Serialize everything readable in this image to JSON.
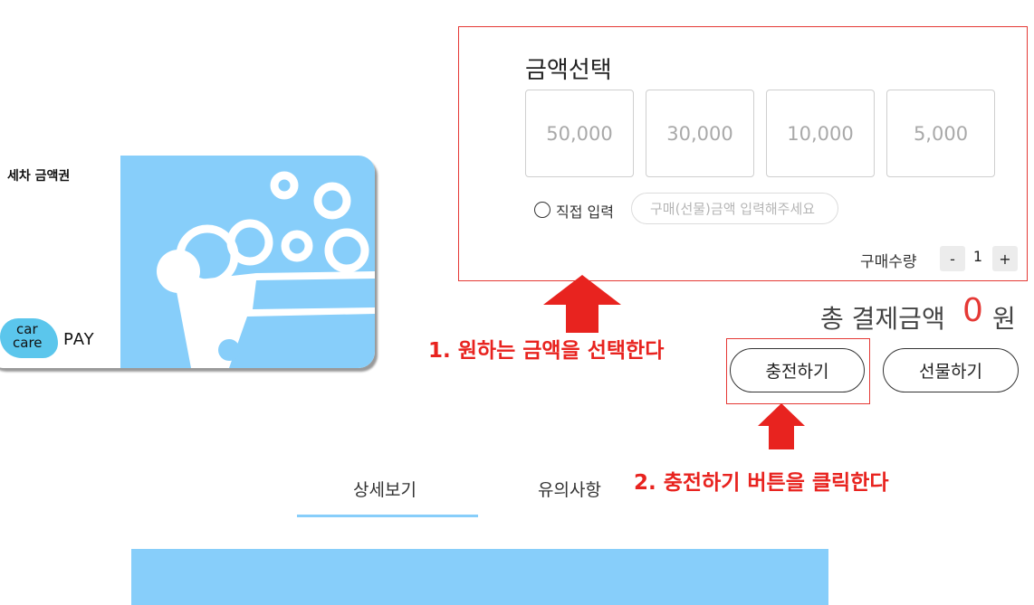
{
  "card": {
    "title": "세차 금액권",
    "logo_car": "car",
    "logo_care": "care",
    "logo_pay": "PAY",
    "art_color": "#87cefa"
  },
  "amount_select": {
    "title": "금액선택",
    "options": [
      "50,000",
      "30,000",
      "10,000",
      "5,000"
    ],
    "direct_input_label": "직접 입력",
    "direct_input_placeholder": "구매(선물)금액 입력해주세요"
  },
  "quantity": {
    "label": "구매수량",
    "minus": "-",
    "value": "1",
    "plus": "+"
  },
  "total": {
    "label": "총 결제금액",
    "value": "0",
    "unit": "원",
    "value_color": "#e53935"
  },
  "actions": {
    "charge": "충전하기",
    "gift": "선물하기"
  },
  "annotations": {
    "step1": "1. 원하는 금액을 선택한다",
    "step2": "2. 충전하기 버튼을 클릭한다",
    "color": "#e8231f"
  },
  "tabs": {
    "detail": "상세보기",
    "notice": "유의사항",
    "active_color": "#87cefa"
  }
}
